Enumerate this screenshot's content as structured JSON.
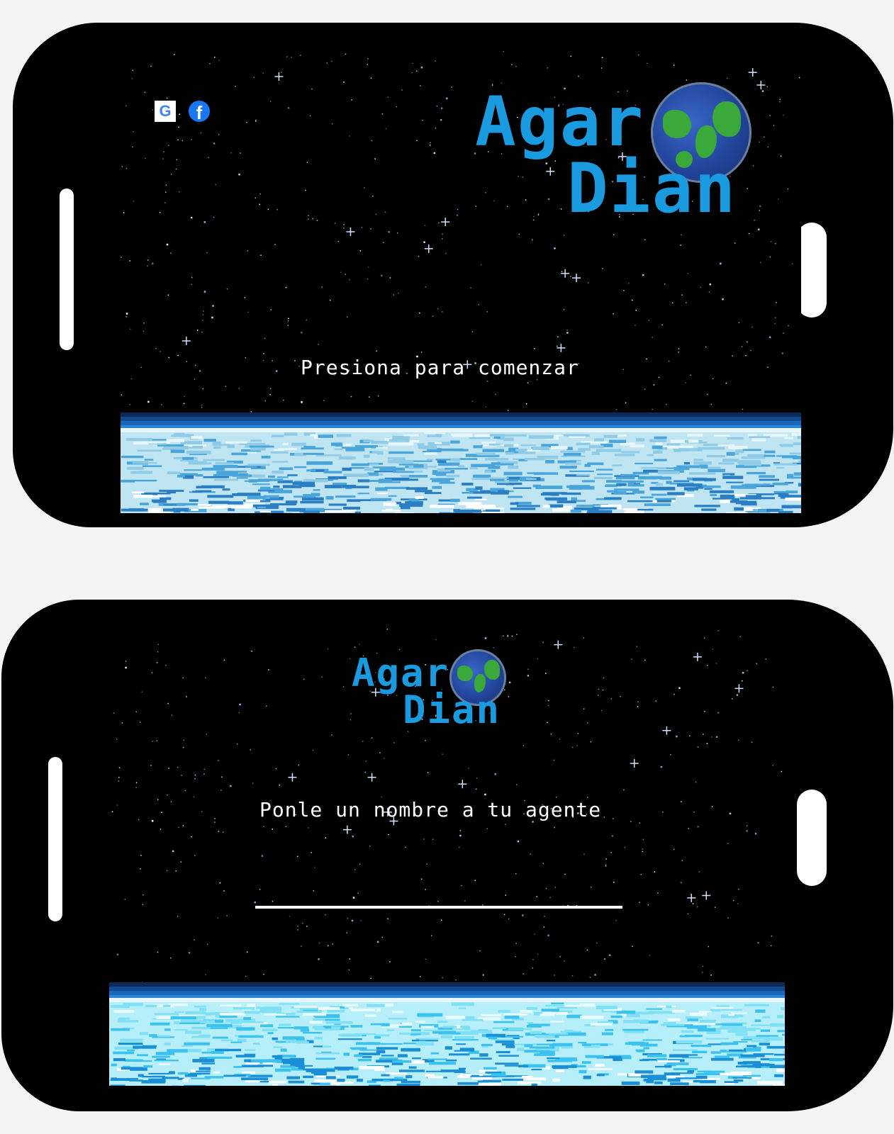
{
  "screen_start": {
    "social": {
      "google_icon": "G",
      "facebook_icon": "f"
    },
    "logo": {
      "line1": "Agar",
      "line2": "Dian"
    },
    "prompt": "Presiona para comenzar"
  },
  "screen_name": {
    "logo": {
      "line1": "Agar",
      "line2": "Dian"
    },
    "prompt": "Ponle un nombre a tu agente",
    "name_input_value": ""
  },
  "colors": {
    "logo_blue": "#1a9be0",
    "globe_land": "#3aa83a",
    "globe_ocean": "#22469c",
    "sky": "#000000",
    "horizon_dark": "#0f3d7a",
    "ice_light": "#cfeef6"
  }
}
